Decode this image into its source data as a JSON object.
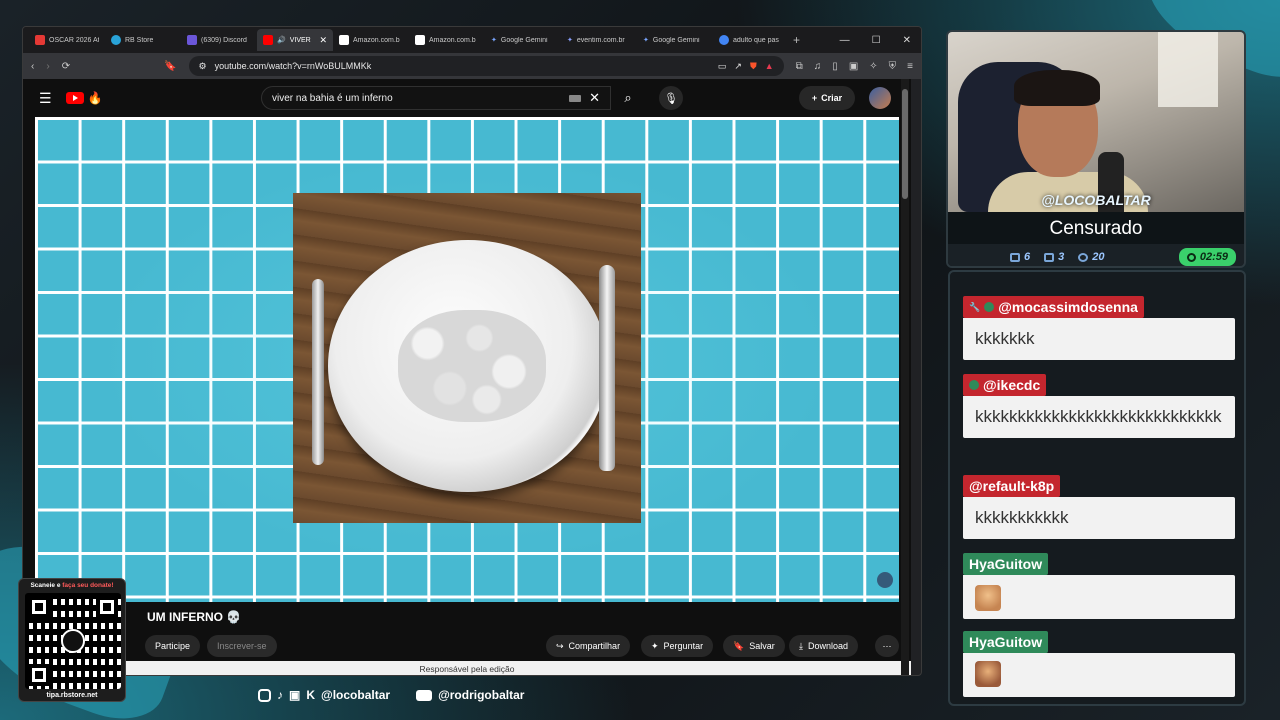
{
  "browser": {
    "tabs": [
      {
        "label": "OSCAR 2026 At",
        "color": "#e53935",
        "active": false
      },
      {
        "label": "RB Store",
        "color": "#29a3d8",
        "active": false
      },
      {
        "label": "(6309) Discord",
        "color": "#6b56d8",
        "active": false
      },
      {
        "label": "VIVER",
        "color": "#ff0000",
        "active": true
      },
      {
        "label": "Amazon.com.b",
        "color": "#ffffff",
        "active": false
      },
      {
        "label": "Amazon.com.b",
        "color": "#ffffff",
        "active": false
      },
      {
        "label": "Google Gemini",
        "color": "#7aa6ff",
        "active": false
      },
      {
        "label": "eventim.com.br",
        "color": "#1c3d8f",
        "active": false
      },
      {
        "label": "Google Gemini",
        "color": "#7aa6ff",
        "active": false
      },
      {
        "label": "adulto que pas",
        "color": "#4285f4",
        "active": false
      }
    ],
    "url": "youtube.com/watch?v=rnWoBULMMKk"
  },
  "youtube": {
    "search_query": "viver na bahia é um inferno",
    "create_label": "Criar",
    "video_title": "UM INFERNO 💀",
    "participe_label": "Participe",
    "subscribe_label": "Inscrever-se",
    "share_label": "Compartilhar",
    "ask_label": "Perguntar",
    "save_label": "Salvar",
    "download_label": "Download",
    "editor_note": "Responsável pela edição"
  },
  "qr": {
    "top_text_plain": "Scaneie e ",
    "top_text_highlight": "faça seu donate!",
    "bottom_text": "tipa.rbstore.net"
  },
  "socials": {
    "handle1": "@locobaltar",
    "handle2": "@rodrigobaltar"
  },
  "stream": {
    "name": "@LOCOBALTAR",
    "status": "Censurado",
    "stat1": "6",
    "stat2": "3",
    "stat3": "20",
    "timer": "02:59"
  },
  "chat": {
    "messages": [
      {
        "user": "@mocassimdosenna",
        "text": "kkkkkkk"
      },
      {
        "user": "@ikecdc",
        "text": "kkkkkkkkkkkkkkkkkkkkkkkkkkkkk"
      },
      {
        "user": "@refault-k8p",
        "text": "kkkkkkkkkkk"
      },
      {
        "user": "HyaGuitow",
        "text": ""
      },
      {
        "user": "HyaGuitow",
        "text": ""
      }
    ]
  }
}
